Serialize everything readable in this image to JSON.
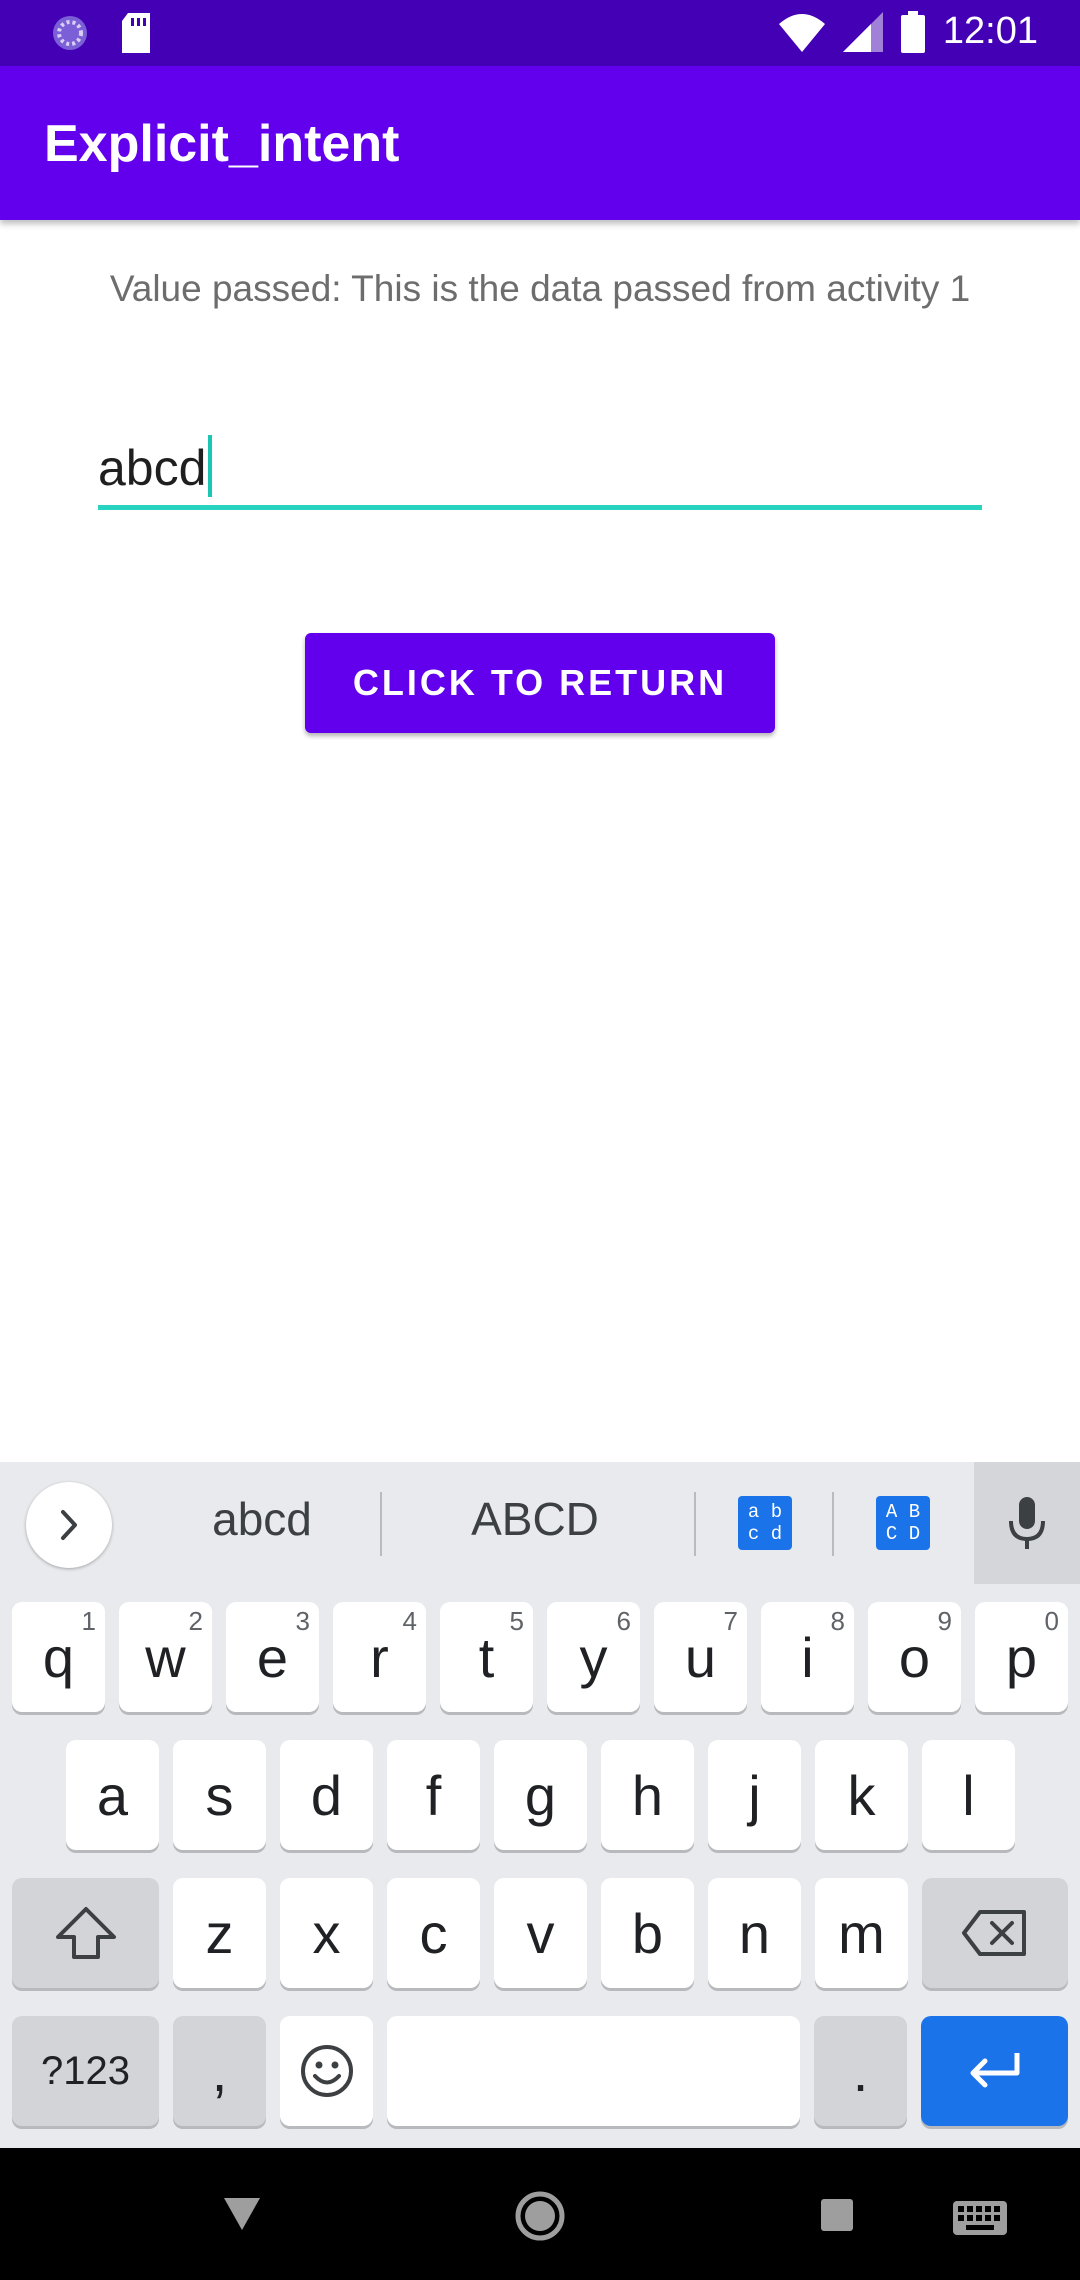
{
  "status_bar": {
    "time": "12:01"
  },
  "app_bar": {
    "title": "Explicit_intent"
  },
  "content": {
    "value_text": "Value passed: This is the data passed from activity 1",
    "edit_value": "abcd",
    "button_label": "CLICK TO RETURN"
  },
  "keyboard": {
    "suggestions": [
      "abcd",
      "ABCD"
    ],
    "case_icon_lower": [
      "a b",
      "c d"
    ],
    "case_icon_upper": [
      "A B",
      "C D"
    ],
    "row1": [
      {
        "key": "q",
        "hint": "1"
      },
      {
        "key": "w",
        "hint": "2"
      },
      {
        "key": "e",
        "hint": "3"
      },
      {
        "key": "r",
        "hint": "4"
      },
      {
        "key": "t",
        "hint": "5"
      },
      {
        "key": "y",
        "hint": "6"
      },
      {
        "key": "u",
        "hint": "7"
      },
      {
        "key": "i",
        "hint": "8"
      },
      {
        "key": "o",
        "hint": "9"
      },
      {
        "key": "p",
        "hint": "0"
      }
    ],
    "row2": [
      "a",
      "s",
      "d",
      "f",
      "g",
      "h",
      "j",
      "k",
      "l"
    ],
    "row3": [
      "z",
      "x",
      "c",
      "v",
      "b",
      "n",
      "m"
    ],
    "symbols_label": "?123",
    "comma": ",",
    "period": "."
  },
  "colors": {
    "status_bar": "#4300b5",
    "primary": "#6200ee",
    "accent": "#28d3c0",
    "keyboard_bg": "#e8eaed",
    "enter_key": "#1a73e8"
  },
  "icons": {
    "status_left": [
      "sync-icon",
      "sd-card-icon"
    ],
    "status_right": [
      "wifi-icon",
      "signal-icon",
      "battery-icon"
    ],
    "keyboard": [
      "chevron-right-icon",
      "mic-icon",
      "shift-icon",
      "backspace-icon",
      "emoji-icon",
      "enter-icon"
    ],
    "nav": [
      "back-icon",
      "home-icon",
      "recents-icon",
      "keyboard-icon"
    ]
  }
}
